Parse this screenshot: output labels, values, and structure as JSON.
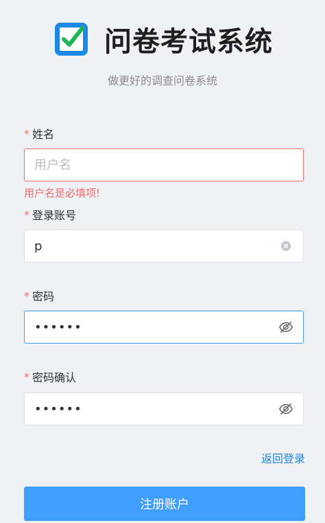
{
  "header": {
    "title": "问卷考试系统",
    "subtitle": "做更好的调查问卷系统",
    "logo_icon": "checkbox-check-icon",
    "logo_colors": {
      "frame": "#1e88e5",
      "check": "#21b55a"
    }
  },
  "form": {
    "name": {
      "required_mark": "*",
      "label": "姓名",
      "value": "",
      "placeholder": "用户名",
      "error": "用户名是必填项!"
    },
    "account": {
      "required_mark": "*",
      "label": "登录账号",
      "value": "p",
      "clear_icon": "clear-icon"
    },
    "password": {
      "required_mark": "*",
      "label": "密码",
      "value": "••••••",
      "toggle_icon": "eye-off-icon"
    },
    "password_confirm": {
      "required_mark": "*",
      "label": "密码确认",
      "value": "••••••",
      "toggle_icon": "eye-off-icon"
    }
  },
  "actions": {
    "back_login": "返回登录",
    "submit": "注册账户"
  },
  "colors": {
    "background": "#eff1f5",
    "primary": "#409eff",
    "error": "#f56c6c",
    "link": "#1e88e5"
  }
}
